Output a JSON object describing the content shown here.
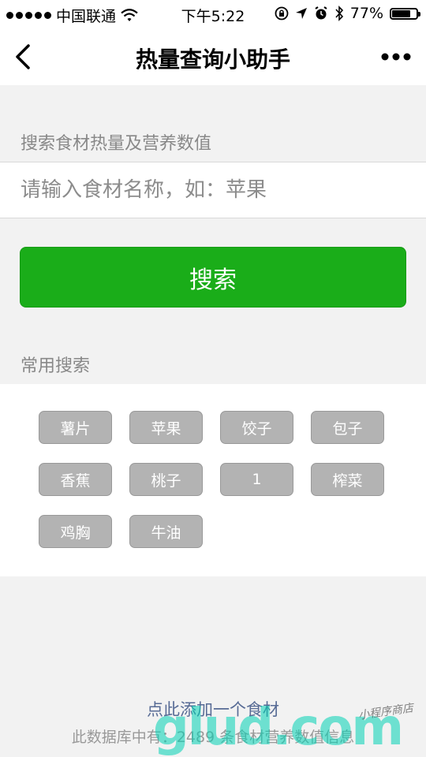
{
  "status_bar": {
    "carrier": "中国联通",
    "time": "下午5:22",
    "battery_percent": "77%",
    "battery_level": 0.77
  },
  "nav": {
    "title": "热量查询小助手"
  },
  "search": {
    "label": "搜索食材热量及营养数值",
    "placeholder": "请输入食材名称，如：苹果",
    "value": "",
    "button_label": "搜索"
  },
  "common": {
    "label": "常用搜索",
    "tags": [
      "薯片",
      "苹果",
      "饺子",
      "包子",
      "香蕉",
      "桃子",
      "1",
      "榨菜",
      "鸡胸",
      "牛油"
    ]
  },
  "footer": {
    "add_link": "点此添加一个食材",
    "db_info": "此数据库中有：2489 条食材营养数值信息"
  },
  "watermark": {
    "text": "glud.com",
    "sub": "小程序商店"
  },
  "colors": {
    "accent_green": "#1aad19",
    "link_blue": "#576b95",
    "tag_gray": "#b3b3b3",
    "background": "#f2f2f2"
  }
}
